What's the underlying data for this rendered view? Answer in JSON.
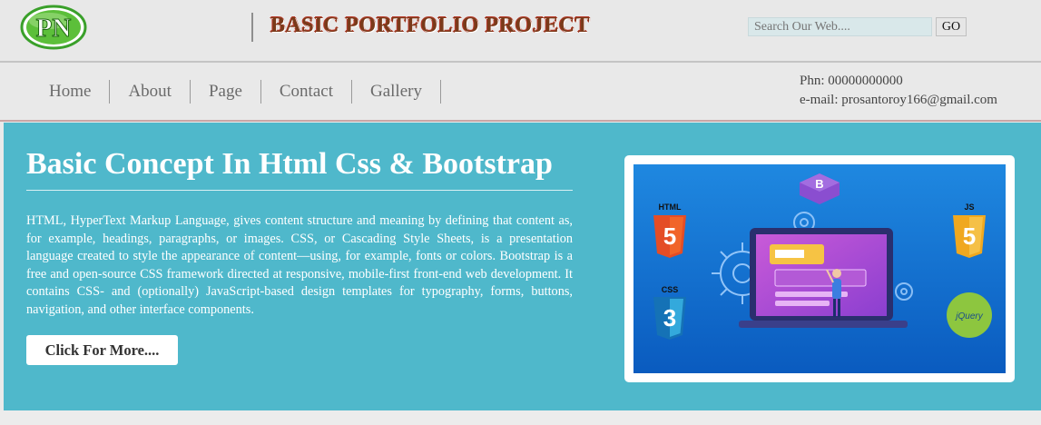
{
  "header": {
    "logo_text": "PN",
    "title": "BASIC PORTFOLIO PROJECT",
    "search_placeholder": "Search Our Web....",
    "go_label": "GO"
  },
  "nav": {
    "items": [
      {
        "label": "Home"
      },
      {
        "label": "About"
      },
      {
        "label": "Page"
      },
      {
        "label": "Contact"
      },
      {
        "label": "Gallery"
      }
    ],
    "phone": "Phn: 00000000000",
    "email": "e-mail: prosantoroy166@gmail.com"
  },
  "hero": {
    "title": "Basic Concept In Html Css & Bootstrap",
    "text": "HTML, HyperText Markup Language, gives content structure and meaning by defining that content as, for example, headings, paragraphs, or images. CSS, or Cascading Style Sheets, is a presentation language created to style the appearance of content—using, for example, fonts or colors. Bootstrap is a free and open-source CSS framework directed at responsive, mobile-first front-end web development. It contains CSS- and (optionally) JavaScript-based design templates for typography, forms, buttons, navigation, and other interface components.",
    "button_label": "Click For More....",
    "image_labels": {
      "html": "HTML",
      "css": "CSS",
      "js": "JS",
      "bootstrap": "B",
      "jquery": "jQuery"
    }
  },
  "colors": {
    "hero_bg": "#4fb8cb",
    "header_bg": "#e8e8e8",
    "title_color": "#7a3a1a",
    "html_orange": "#e44d26",
    "css_blue": "#1572b6",
    "js_yellow": "#f0a81f",
    "bootstrap_purple": "#7952b3",
    "jquery_green": "#8dc63f"
  }
}
